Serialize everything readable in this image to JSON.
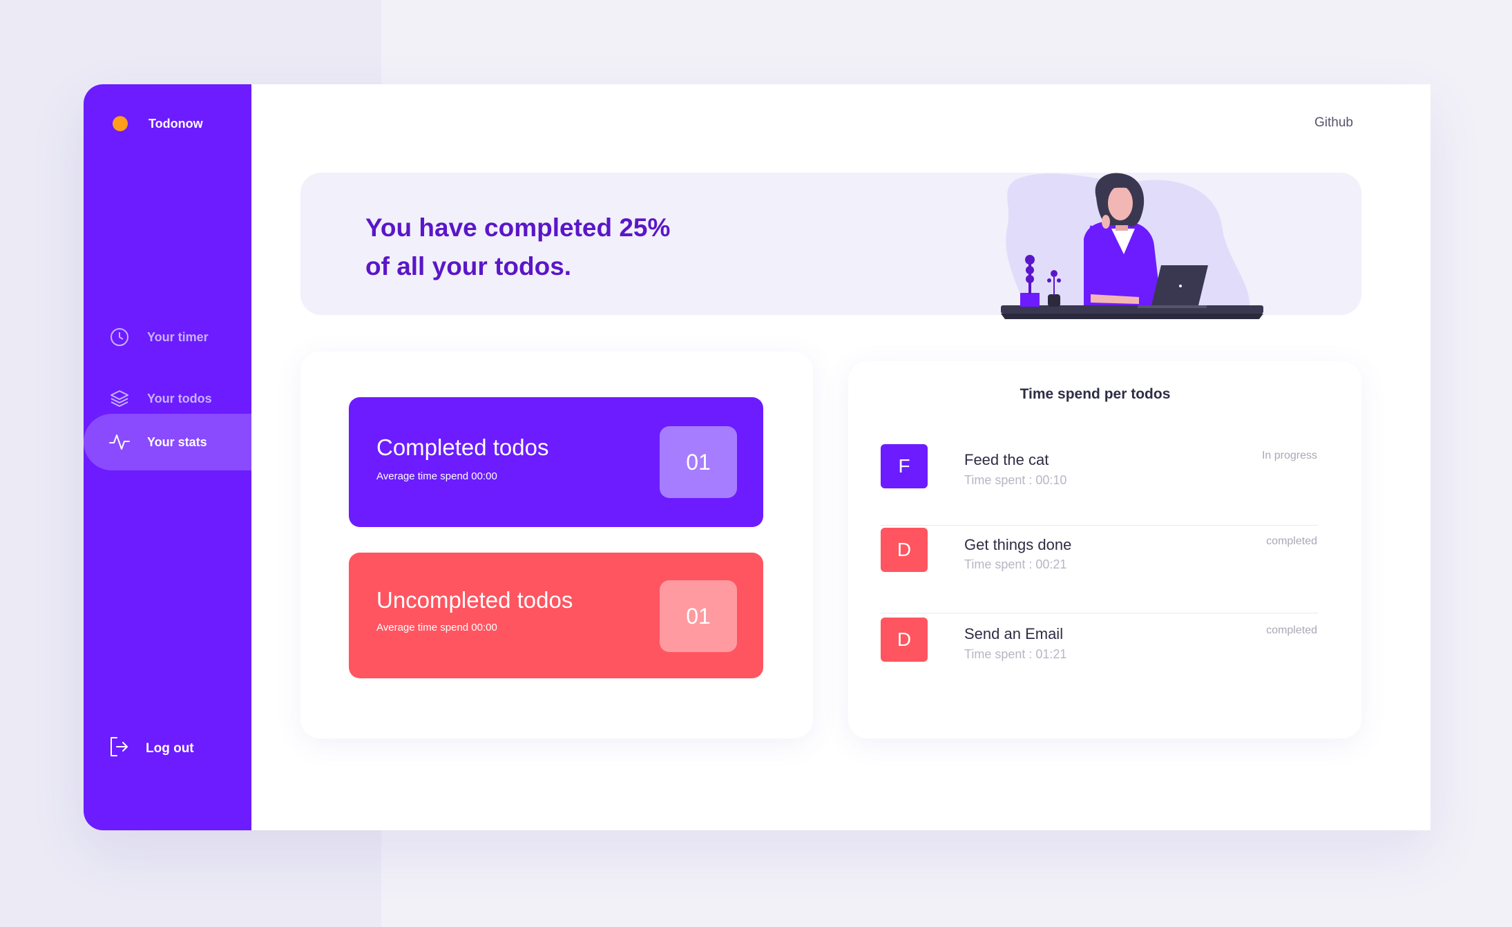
{
  "app": {
    "name": "Todonow"
  },
  "header": {
    "github": "Github"
  },
  "sidebar": {
    "items": [
      {
        "label": "Your timer",
        "icon": "clock-icon"
      },
      {
        "label": "Your todos",
        "icon": "layers-icon"
      },
      {
        "label": "Your stats",
        "icon": "activity-icon"
      }
    ],
    "logout": "Log out"
  },
  "hero": {
    "line1": "You have completed 25%",
    "line2": "of all your todos."
  },
  "stats": {
    "completed": {
      "title": "Completed todos",
      "sub": "Average time spend 00:00",
      "count": "01"
    },
    "uncompleted": {
      "title": "Uncompleted todos",
      "sub": "Average time spend 00:00",
      "count": "01"
    }
  },
  "todos": {
    "title": "Time spend per todos",
    "items": [
      {
        "badge": "F",
        "name": "Feed the cat",
        "time": "Time spent : 00:10",
        "status": "In progress",
        "color": "#6c1cff"
      },
      {
        "badge": "D",
        "name": "Get things done",
        "time": "Time spent : 00:21",
        "status": "completed",
        "color": "#ff5560"
      },
      {
        "badge": "D",
        "name": "Send an Email",
        "time": "Time spent : 01:21",
        "status": "completed",
        "color": "#ff5560"
      }
    ]
  },
  "colors": {
    "primary": "#6c1cff",
    "danger": "#ff5560",
    "accent": "#ff9d1c",
    "heroText": "#5a16c8"
  }
}
